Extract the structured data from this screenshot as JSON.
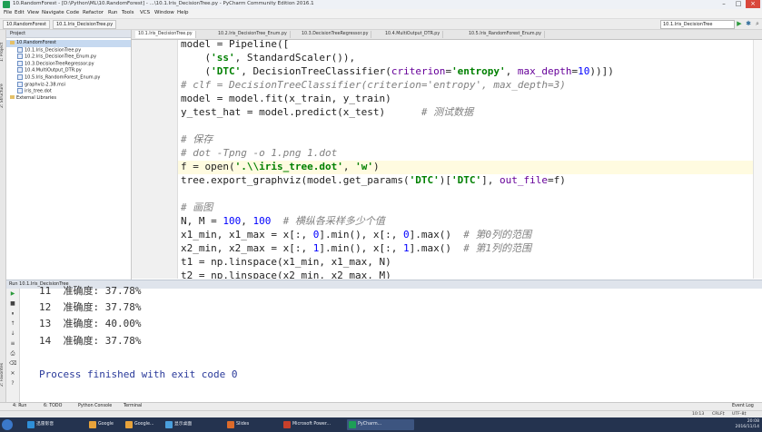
{
  "window": {
    "title": "10.RandomForest - [D:\\Python\\ML\\10.RandomForest] - ...\\10.1.Iris_DecisionTree.py - PyCharm Community Edition 2016.1"
  },
  "menu": [
    "File",
    "Edit",
    "View",
    "Navigate",
    "Code",
    "Refactor",
    "Run",
    "Tools",
    "VCS",
    "Window",
    "Help"
  ],
  "nav": {
    "breadcrumbs": [
      "10.RandomForest",
      "10.1.Iris_DecisionTree.py"
    ],
    "run_config": "10.1.Iris_DecisionTree"
  },
  "left_strip": {
    "tabs": [
      "1: Project",
      "2: Structure"
    ],
    "bottom_tab": "2: Favorites"
  },
  "project": {
    "header": "Project",
    "tree": [
      {
        "label": "10.RandomForest",
        "kind": "folder",
        "selected": true,
        "indent": 1
      },
      {
        "label": "10.1.Iris_DecisionTree.py",
        "kind": "file",
        "indent": 2
      },
      {
        "label": "10.2.Iris_DecisionTree_Enum.py",
        "kind": "file",
        "indent": 2
      },
      {
        "label": "10.3.DecisionTreeRegressor.py",
        "kind": "file",
        "indent": 2
      },
      {
        "label": "10.4.MultiOutput_DTR.py",
        "kind": "file",
        "indent": 2
      },
      {
        "label": "10.5.Iris_RandomForest_Enum.py",
        "kind": "file",
        "indent": 2
      },
      {
        "label": "graphviz-2.38.msi",
        "kind": "file",
        "indent": 2
      },
      {
        "label": "iris_tree.dot",
        "kind": "file",
        "indent": 2
      },
      {
        "label": "External Libraries",
        "kind": "folder",
        "indent": 1
      }
    ]
  },
  "editor": {
    "tabs": [
      {
        "label": "10.1.Iris_DecisionTree.py",
        "active": true
      },
      {
        "label": "10.2.Iris_DecisionTree_Enum.py"
      },
      {
        "label": "10.3.DecisionTreeRegressor.py"
      },
      {
        "label": "10.4.MultiOutput_DTR.py"
      },
      {
        "label": "10.5.Iris_RandomForest_Enum.py"
      }
    ],
    "lines": [
      [
        [
          "",
          "model = Pipeline(["
        ]
      ],
      [
        [
          "",
          "    ("
        ],
        [
          "str",
          "'ss'"
        ],
        [
          "",
          ", StandardScaler()),"
        ]
      ],
      [
        [
          "",
          "    ("
        ],
        [
          "str",
          "'DTC'"
        ],
        [
          "",
          ", DecisionTreeClassifier("
        ],
        [
          "param",
          "criterion"
        ],
        [
          "",
          "="
        ],
        [
          "str",
          "'entropy'"
        ],
        [
          "",
          ", "
        ],
        [
          "param",
          "max_depth"
        ],
        [
          "",
          "="
        ],
        [
          "num",
          "10"
        ],
        [
          "",
          "))])"
        ]
      ],
      [
        [
          "cm",
          "# clf = DecisionTreeClassifier(criterion='entropy', max_depth=3)"
        ]
      ],
      [
        [
          "",
          "model = model.fit(x_train, y_train)"
        ]
      ],
      [
        [
          "",
          "y_test_hat = model.predict(x_test)      "
        ],
        [
          "cm",
          "# 测试数据"
        ]
      ],
      [
        [
          "",
          ""
        ]
      ],
      [
        [
          "cm",
          "# 保存"
        ]
      ],
      [
        [
          "cm",
          "# dot -Tpng -o 1.png 1.dot"
        ]
      ],
      [
        [
          "",
          "f = open("
        ],
        [
          "str",
          "'.\\\\iris_tree.dot'"
        ],
        [
          "",
          ", "
        ],
        [
          "str",
          "'w'"
        ],
        [
          "",
          ")"
        ]
      ],
      [
        [
          "",
          "tree.export_graphviz(model.get_params("
        ],
        [
          "str",
          "'DTC'"
        ],
        [
          "",
          ")["
        ],
        [
          "str",
          "'DTC'"
        ],
        [
          "",
          "], "
        ],
        [
          "param",
          "out_file"
        ],
        [
          "",
          "=f)"
        ]
      ],
      [
        [
          "",
          ""
        ]
      ],
      [
        [
          "cm",
          "# 画图"
        ]
      ],
      [
        [
          "",
          "N, M = "
        ],
        [
          "num",
          "100"
        ],
        [
          "",
          ", "
        ],
        [
          "num",
          "100"
        ],
        [
          "",
          "  "
        ],
        [
          "cm",
          "# 横纵各采样多少个值"
        ]
      ],
      [
        [
          "",
          "x1_min, x1_max = x[:, "
        ],
        [
          "num",
          "0"
        ],
        [
          "",
          "].min(), x[:, "
        ],
        [
          "num",
          "0"
        ],
        [
          "",
          "].max()  "
        ],
        [
          "cm",
          "# 第0列的范围"
        ]
      ],
      [
        [
          "",
          "x2_min, x2_max = x[:, "
        ],
        [
          "num",
          "1"
        ],
        [
          "",
          "].min(), x[:, "
        ],
        [
          "num",
          "1"
        ],
        [
          "",
          "].max()  "
        ],
        [
          "cm",
          "# 第1列的范围"
        ]
      ],
      [
        [
          "",
          "t1 = np.linspace(x1_min, x1_max, N)"
        ]
      ],
      [
        [
          "",
          "t2 = np.linspace(x2_min, x2_max, M)"
        ]
      ]
    ]
  },
  "run": {
    "header": "Run  10.1.Iris_DecisionTree",
    "output": [
      "11  准确度: 37.78%",
      "12  准确度: 37.78%",
      "13  准确度: 40.00%",
      "14  准确度: 37.78%",
      "",
      "Process finished with exit code 0"
    ]
  },
  "bottom_tabs": [
    "4: Run",
    "6: TODO",
    "Python Console",
    "Terminal"
  ],
  "event_log": "Event Log",
  "status": {
    "position": "10:13",
    "line_sep": "CRLF‡",
    "encoding": "UTF-8‡"
  },
  "taskbar": {
    "items": [
      {
        "label": "迅雷影音"
      },
      {
        "label": "Google"
      },
      {
        "label": "Google..."
      },
      {
        "label": "显示桌面"
      },
      {
        "label": "Slides"
      },
      {
        "label": "Microsoft Power..."
      },
      {
        "label": "PyCharm...",
        "active": true
      }
    ],
    "time": "20:08",
    "date": "2016/11/14"
  },
  "colors": {
    "accent": "#1d9e56",
    "comment": "#808080",
    "string": "#008000",
    "keyword": "#000080",
    "number": "#0000ff"
  }
}
